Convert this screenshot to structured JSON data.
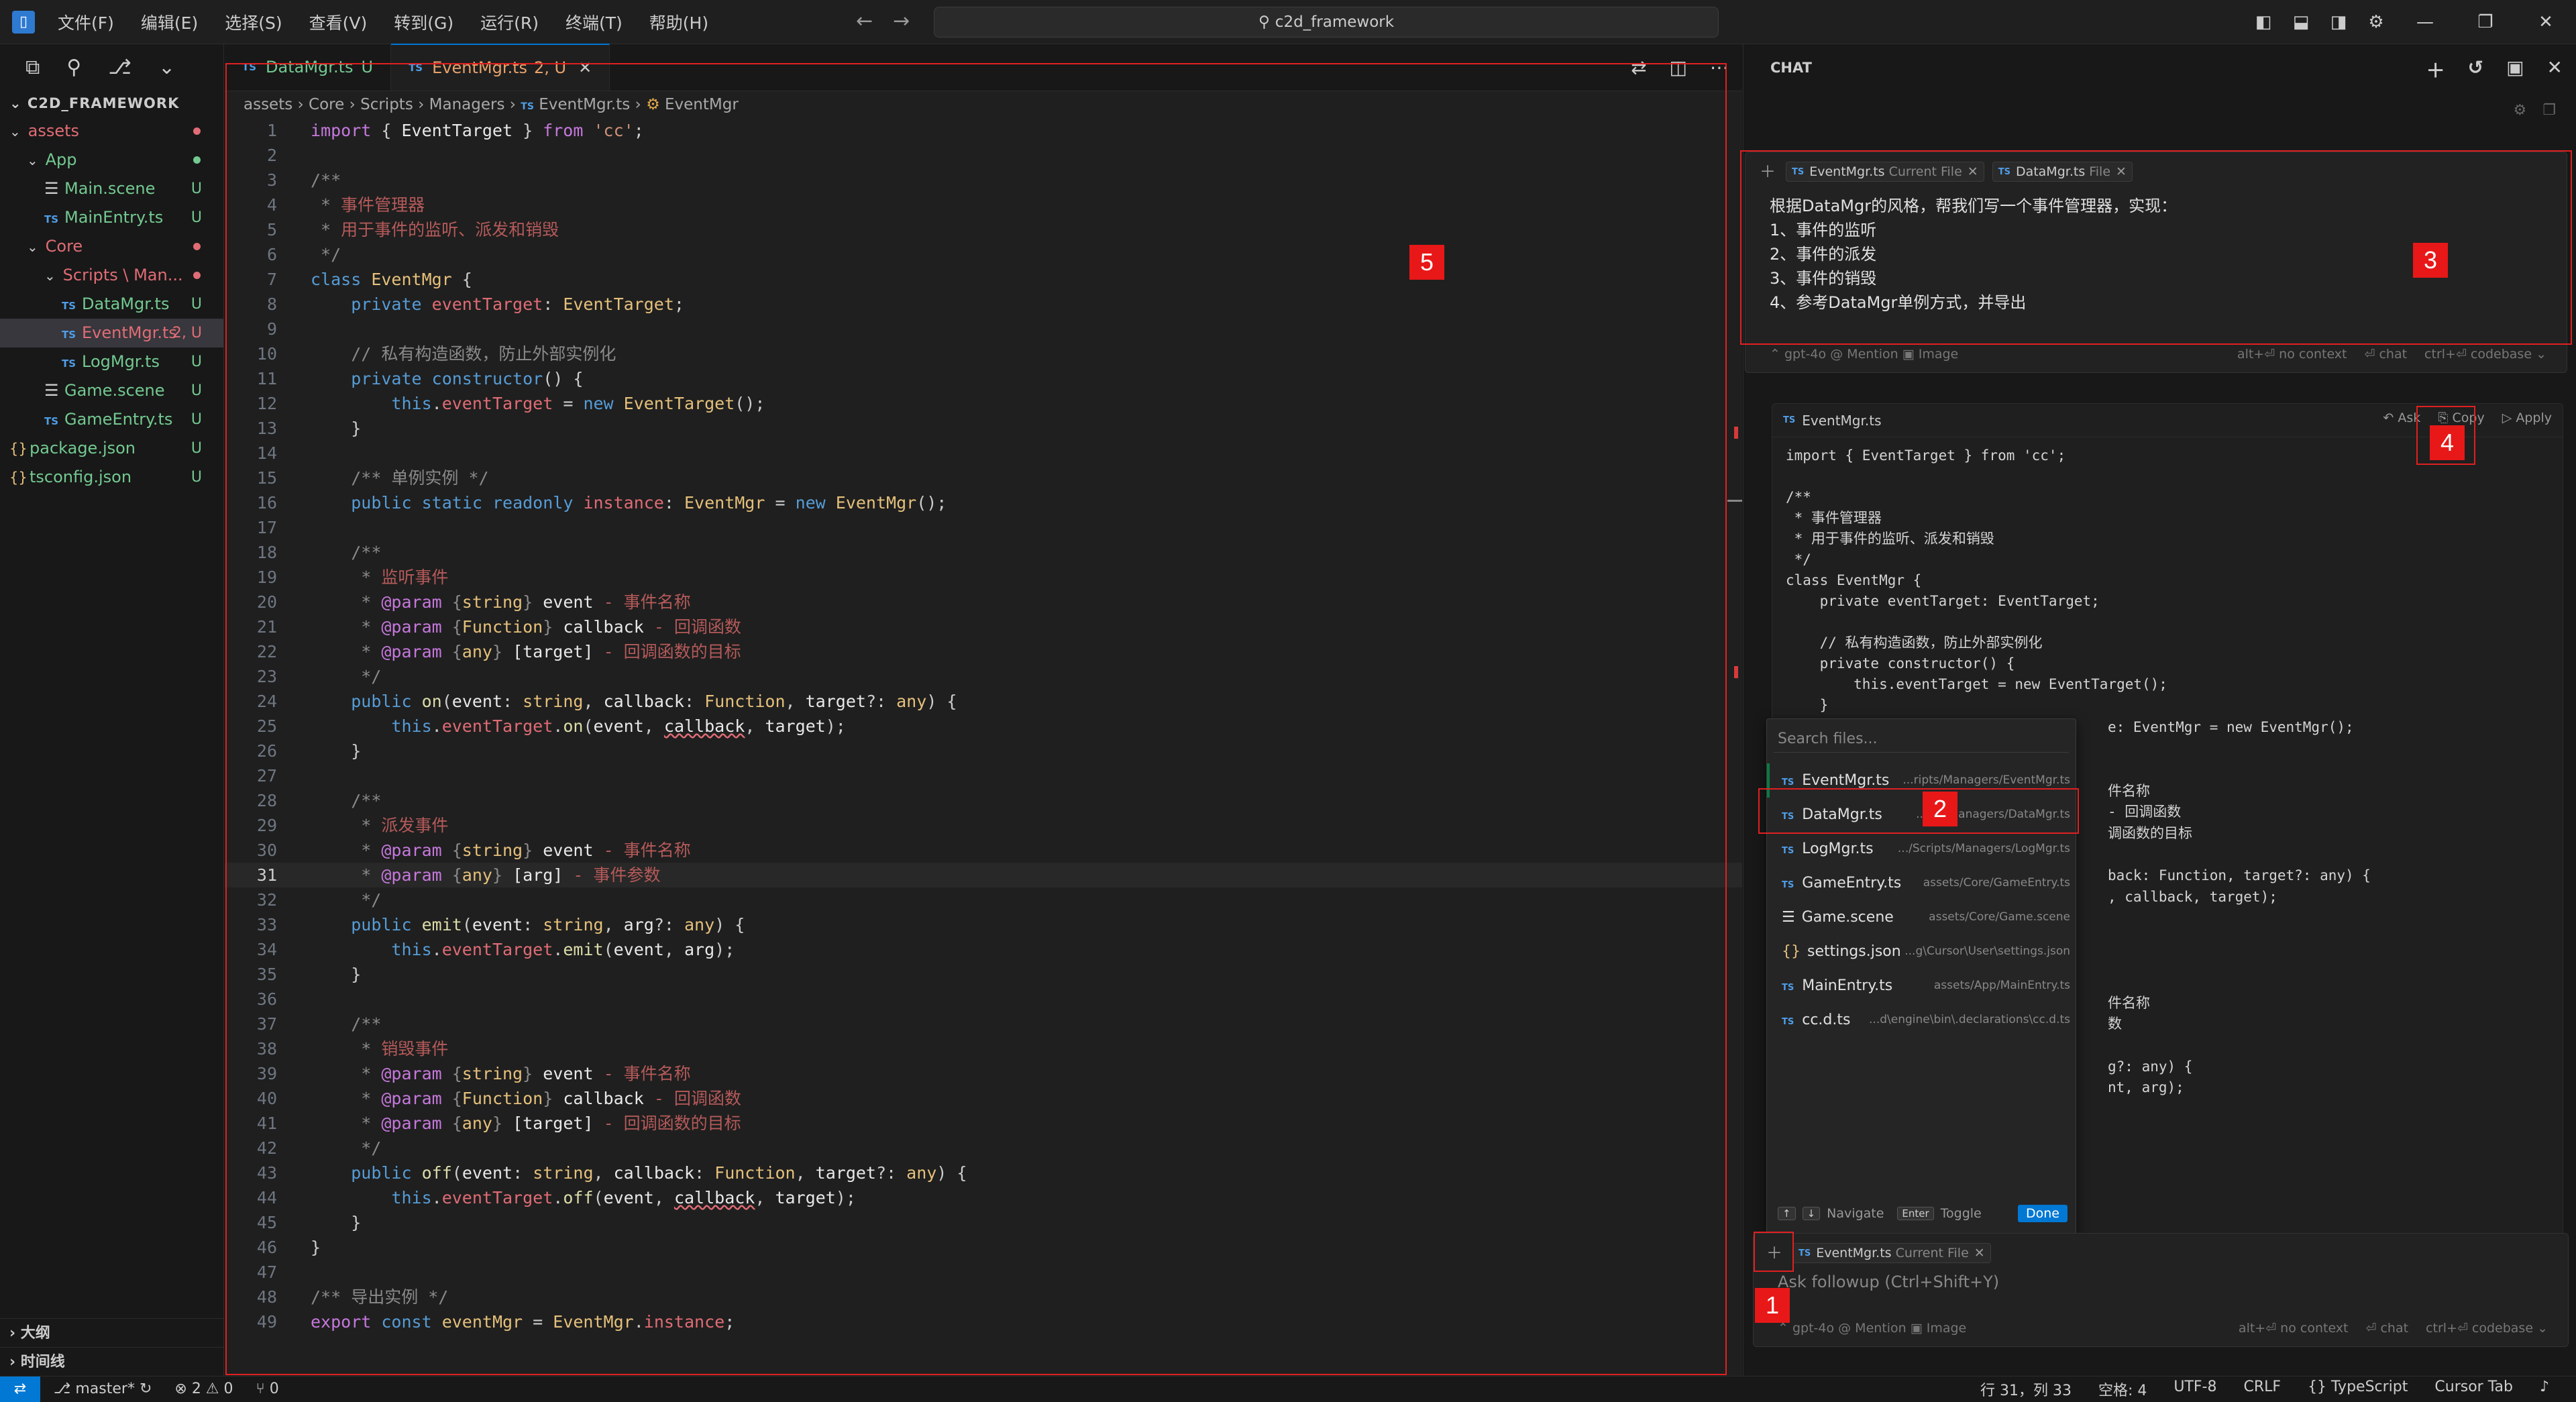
{
  "menu": [
    "文件(F)",
    "编辑(E)",
    "选择(S)",
    "查看(V)",
    "转到(G)",
    "运行(R)",
    "终端(T)",
    "帮助(H)"
  ],
  "search": {
    "label": "c2d_framework"
  },
  "explorer": {
    "title": "C2D_FRAMEWORK",
    "rows": [
      {
        "label": "assets",
        "indent": 0,
        "kind": "folder",
        "open": true,
        "badge": "",
        "dot": "#e06c75",
        "color": "c-red"
      },
      {
        "label": "App",
        "indent": 1,
        "kind": "folder",
        "open": true,
        "badge": "",
        "dot": "#73c991",
        "color": "c-green"
      },
      {
        "label": "Main.scene",
        "indent": 2,
        "kind": "scene",
        "badge": "U",
        "color": "c-green"
      },
      {
        "label": "MainEntry.ts",
        "indent": 2,
        "kind": "ts",
        "badge": "U",
        "color": "c-green"
      },
      {
        "label": "Core",
        "indent": 1,
        "kind": "folder",
        "open": true,
        "badge": "",
        "dot": "#e06c75",
        "color": "c-red"
      },
      {
        "label": "Scripts \\ Man...",
        "indent": 2,
        "kind": "folder",
        "open": true,
        "badge": "",
        "dot": "#e06c75",
        "color": "c-red"
      },
      {
        "label": "DataMgr.ts",
        "indent": 3,
        "kind": "ts",
        "badge": "U",
        "color": "c-green"
      },
      {
        "label": "EventMgr.ts",
        "indent": 3,
        "kind": "ts",
        "badge": "2, U",
        "color": "c-red",
        "active": true
      },
      {
        "label": "LogMgr.ts",
        "indent": 3,
        "kind": "ts",
        "badge": "U",
        "color": "c-green"
      },
      {
        "label": "Game.scene",
        "indent": 2,
        "kind": "scene",
        "badge": "U",
        "color": "c-green"
      },
      {
        "label": "GameEntry.ts",
        "indent": 2,
        "kind": "ts",
        "badge": "U",
        "color": "c-green"
      },
      {
        "label": "package.json",
        "indent": 0,
        "kind": "json",
        "badge": "U",
        "color": "c-green"
      },
      {
        "label": "tsconfig.json",
        "indent": 0,
        "kind": "json",
        "badge": "U",
        "color": "c-green"
      }
    ],
    "outline": "大纲",
    "timeline": "时间线"
  },
  "editor": {
    "tabs": [
      {
        "label": "DataMgr.ts",
        "suffix": "U",
        "active": false
      },
      {
        "label": "EventMgr.ts",
        "suffix": "2, U",
        "active": true
      }
    ],
    "breadcrumb": [
      "assets",
      "Core",
      "Scripts",
      "Managers",
      "EventMgr.ts",
      "EventMgr"
    ],
    "current_line": 31,
    "lines": [
      "<span class=\"kw\">import</span> { <span class=\"var\">EventTarget</span> } <span class=\"kw\">from</span> <span class=\"str\">'cc'</span>;",
      "",
      "<span class=\"cm\">/**</span>",
      "<span class=\"cm\"> * </span><span class=\"cmcn\">事件管理器</span>",
      "<span class=\"cm\"> * </span><span class=\"cmcn\">用于事件的监听、派发和销毁</span>",
      "<span class=\"cm\"> */</span>",
      "<span class=\"kw2\">class</span> <span class=\"ty\">EventMgr</span> {",
      "    <span class=\"kw2\">private</span> <span class=\"pr\">eventTarget</span>: <span class=\"ty\">EventTarget</span>;",
      "",
      "    <span class=\"cm\">// 私有构造函数，防止外部实例化</span>",
      "    <span class=\"kw2\">private</span> <span class=\"kw2\">constructor</span>() {",
      "        <span class=\"kw2\">this</span>.<span class=\"pr\">eventTarget</span> = <span class=\"kw2\">new</span> <span class=\"ty\">EventTarget</span>();",
      "    }",
      "",
      "    <span class=\"cm\">/** 单例实例 */</span>",
      "    <span class=\"kw2\">public</span> <span class=\"kw2\">static</span> <span class=\"kw2\">readonly</span> <span class=\"pr\">instance</span>: <span class=\"ty\">EventMgr</span> = <span class=\"kw2\">new</span> <span class=\"ty\">EventMgr</span>();",
      "",
      "    <span class=\"cm\">/**</span>",
      "<span class=\"cm\">     * </span><span class=\"cmcn\">监听事件</span>",
      "<span class=\"cm\">     * </span><span class=\"kw\">@param</span> <span class=\"cm\">{</span><span class=\"ty\">string</span><span class=\"cm\">}</span> <span class=\"var\">event</span> <span class=\"cmcn\">- 事件名称</span>",
      "<span class=\"cm\">     * </span><span class=\"kw\">@param</span> <span class=\"cm\">{</span><span class=\"ty\">Function</span><span class=\"cm\">}</span> <span class=\"var\">callback</span> <span class=\"cmcn\">- 回调函数</span>",
      "<span class=\"cm\">     * </span><span class=\"kw\">@param</span> <span class=\"cm\">{</span><span class=\"ty\">any</span><span class=\"cm\">}</span> <span class=\"var\">[target]</span> <span class=\"cmcn\">- 回调函数的目标</span>",
      "<span class=\"cm\">     */</span>",
      "    <span class=\"kw2\">public</span> <span class=\"fn\">on</span>(<span class=\"var\">event</span>: <span class=\"ty\">string</span>, <span class=\"var\">callback</span>: <span class=\"ty\">Function</span>, <span class=\"var\">target</span>?: <span class=\"ty\">any</span>) {",
      "        <span class=\"kw2\">this</span>.<span class=\"pr\">eventTarget</span>.<span class=\"fn\">on</span>(<span class=\"var\">event</span>, <span class=\"var squig\">callback</span>, <span class=\"var\">target</span>);",
      "    }",
      "",
      "    <span class=\"cm\">/**</span>",
      "<span class=\"cm\">     * </span><span class=\"cmcn\">派发事件</span>",
      "<span class=\"cm\">     * </span><span class=\"kw\">@param</span> <span class=\"cm\">{</span><span class=\"ty\">string</span><span class=\"cm\">}</span> <span class=\"var\">event</span> <span class=\"cmcn\">- 事件名称</span>",
      "<span class=\"cm\">     * </span><span class=\"kw\">@param</span> <span class=\"cm\">{</span><span class=\"ty\">any</span><span class=\"cm\">}</span> <span class=\"var\">[arg]</span> <span class=\"cmcn\">- 事件参数</span>",
      "<span class=\"cm\">     */</span>",
      "    <span class=\"kw2\">public</span> <span class=\"fn\">emit</span>(<span class=\"var\">event</span>: <span class=\"ty\">string</span>, <span class=\"var\">arg</span>?: <span class=\"ty\">any</span>) {",
      "        <span class=\"kw2\">this</span>.<span class=\"pr\">eventTarget</span>.<span class=\"fn\">emit</span>(<span class=\"var\">event</span>, <span class=\"var\">arg</span>);",
      "    }",
      "",
      "    <span class=\"cm\">/**</span>",
      "<span class=\"cm\">     * </span><span class=\"cmcn\">销毁事件</span>",
      "<span class=\"cm\">     * </span><span class=\"kw\">@param</span> <span class=\"cm\">{</span><span class=\"ty\">string</span><span class=\"cm\">}</span> <span class=\"var\">event</span> <span class=\"cmcn\">- 事件名称</span>",
      "<span class=\"cm\">     * </span><span class=\"kw\">@param</span> <span class=\"cm\">{</span><span class=\"ty\">Function</span><span class=\"cm\">}</span> <span class=\"var\">callback</span> <span class=\"cmcn\">- 回调函数</span>",
      "<span class=\"cm\">     * </span><span class=\"kw\">@param</span> <span class=\"cm\">{</span><span class=\"ty\">any</span><span class=\"cm\">}</span> <span class=\"var\">[target]</span> <span class=\"cmcn\">- 回调函数的目标</span>",
      "<span class=\"cm\">     */</span>",
      "    <span class=\"kw2\">public</span> <span class=\"fn\">off</span>(<span class=\"var\">event</span>: <span class=\"ty\">string</span>, <span class=\"var\">callback</span>: <span class=\"ty\">Function</span>, <span class=\"var\">target</span>?: <span class=\"ty\">any</span>) {",
      "        <span class=\"kw2\">this</span>.<span class=\"pr\">eventTarget</span>.<span class=\"fn\">off</span>(<span class=\"var\">event</span>, <span class=\"var squig\">callback</span>, <span class=\"var\">target</span>);",
      "    }",
      "}",
      "",
      "<span class=\"cm\">/** 导出实例 */</span>",
      "<span class=\"kw\">export</span> <span class=\"kw2\">const</span> <span class=\"ty\">eventMgr</span> = <span class=\"ty\">EventMgr</span>.<span class=\"pr\">instance</span>;"
    ]
  },
  "chat": {
    "title": "CHAT",
    "message": {
      "chips": [
        {
          "label": "EventMgr.ts",
          "tag": "Current File"
        },
        {
          "label": "DataMgr.ts",
          "tag": "File"
        }
      ],
      "lines": [
        "根据DataMgr的风格，帮我们写一个事件管理器，实现：",
        "1、事件的监听",
        "2、事件的派发",
        "3、事件的销毁",
        "4、参考DataMgr单例方式，并导出"
      ],
      "footer_left": "⌃ gpt-4o   @ Mention   ▣ Image",
      "footer_right": [
        "alt+⏎ no context",
        "⏎ chat",
        "ctrl+⏎ codebase ⌄"
      ]
    },
    "code_card": {
      "filename": "EventMgr.ts",
      "actions": [
        "↶ Ask",
        "⎘ Copy",
        "▷ Apply"
      ],
      "code": "import { EventTarget } from 'cc';\n\n/**\n * 事件管理器\n * 用于事件的监听、派发和销毁\n */\nclass EventMgr {\n    private eventTarget: EventTarget;\n\n    // 私有构造函数，防止外部实例化\n    private constructor() {\n        this.eventTarget = new EventTarget();\n    }",
      "right_fragments": [
        "e: EventMgr = new EventMgr();",
        "",
        "",
        "件名称",
        "- 回调函数",
        "调函数的目标",
        "",
        "back: Function, target?: any) {",
        ", callback, target);",
        "",
        "",
        "",
        "",
        "件名称",
        "数",
        "",
        "g?: any) {",
        "nt, arg);"
      ]
    },
    "picker": {
      "placeholder": "Search files...",
      "items": [
        {
          "kind": "ts",
          "name": "EventMgr.ts",
          "path": "...ripts/Managers/EventMgr.ts"
        },
        {
          "kind": "ts",
          "name": "DataMgr.ts",
          "path": "...cri  /Managers/DataMgr.ts"
        },
        {
          "kind": "ts",
          "name": "LogMgr.ts",
          "path": ".../Scripts/Managers/LogMgr.ts"
        },
        {
          "kind": "ts",
          "name": "GameEntry.ts",
          "path": "assets/Core/GameEntry.ts"
        },
        {
          "kind": "scene",
          "name": "Game.scene",
          "path": "assets/Core/Game.scene"
        },
        {
          "kind": "json",
          "name": "settings.json",
          "path": "...g\\Cursor\\User\\settings.json"
        },
        {
          "kind": "ts",
          "name": "MainEntry.ts",
          "path": "assets/App/MainEntry.ts"
        },
        {
          "kind": "ts",
          "name": "cc.d.ts",
          "path": "...d\\engine\\bin\\.declarations\\cc.d.ts"
        }
      ],
      "foot_navigate": "Navigate",
      "foot_enter": "Enter",
      "foot_toggle": "Toggle",
      "done": "Done"
    },
    "followup": {
      "chip_label": "EventMgr.ts",
      "chip_tag": "Current File",
      "placeholder": "Ask followup (Ctrl+Shift+Y)",
      "footer_left": "⌃ gpt-4o   @ Mention   ▣ Image",
      "footer_right": [
        "alt+⏎ no context",
        "⏎ chat",
        "ctrl+⏎ codebase ⌄"
      ]
    }
  },
  "status": {
    "branch": "master*",
    "problems": "⊗ 2 ⚠ 0",
    "ports": "⑂ 0",
    "position": "行 31，列 33",
    "spaces": "空格: 4",
    "encoding": "UTF-8",
    "eol": "CRLF",
    "language": "{} TypeScript",
    "tab_mode": "Cursor Tab"
  },
  "annotations": [
    "1",
    "2",
    "3",
    "4",
    "5"
  ],
  "colors": {
    "accent": "#0078d4",
    "annotation": "#e02020",
    "untracked": "#73c991",
    "error": "#e06c75"
  }
}
